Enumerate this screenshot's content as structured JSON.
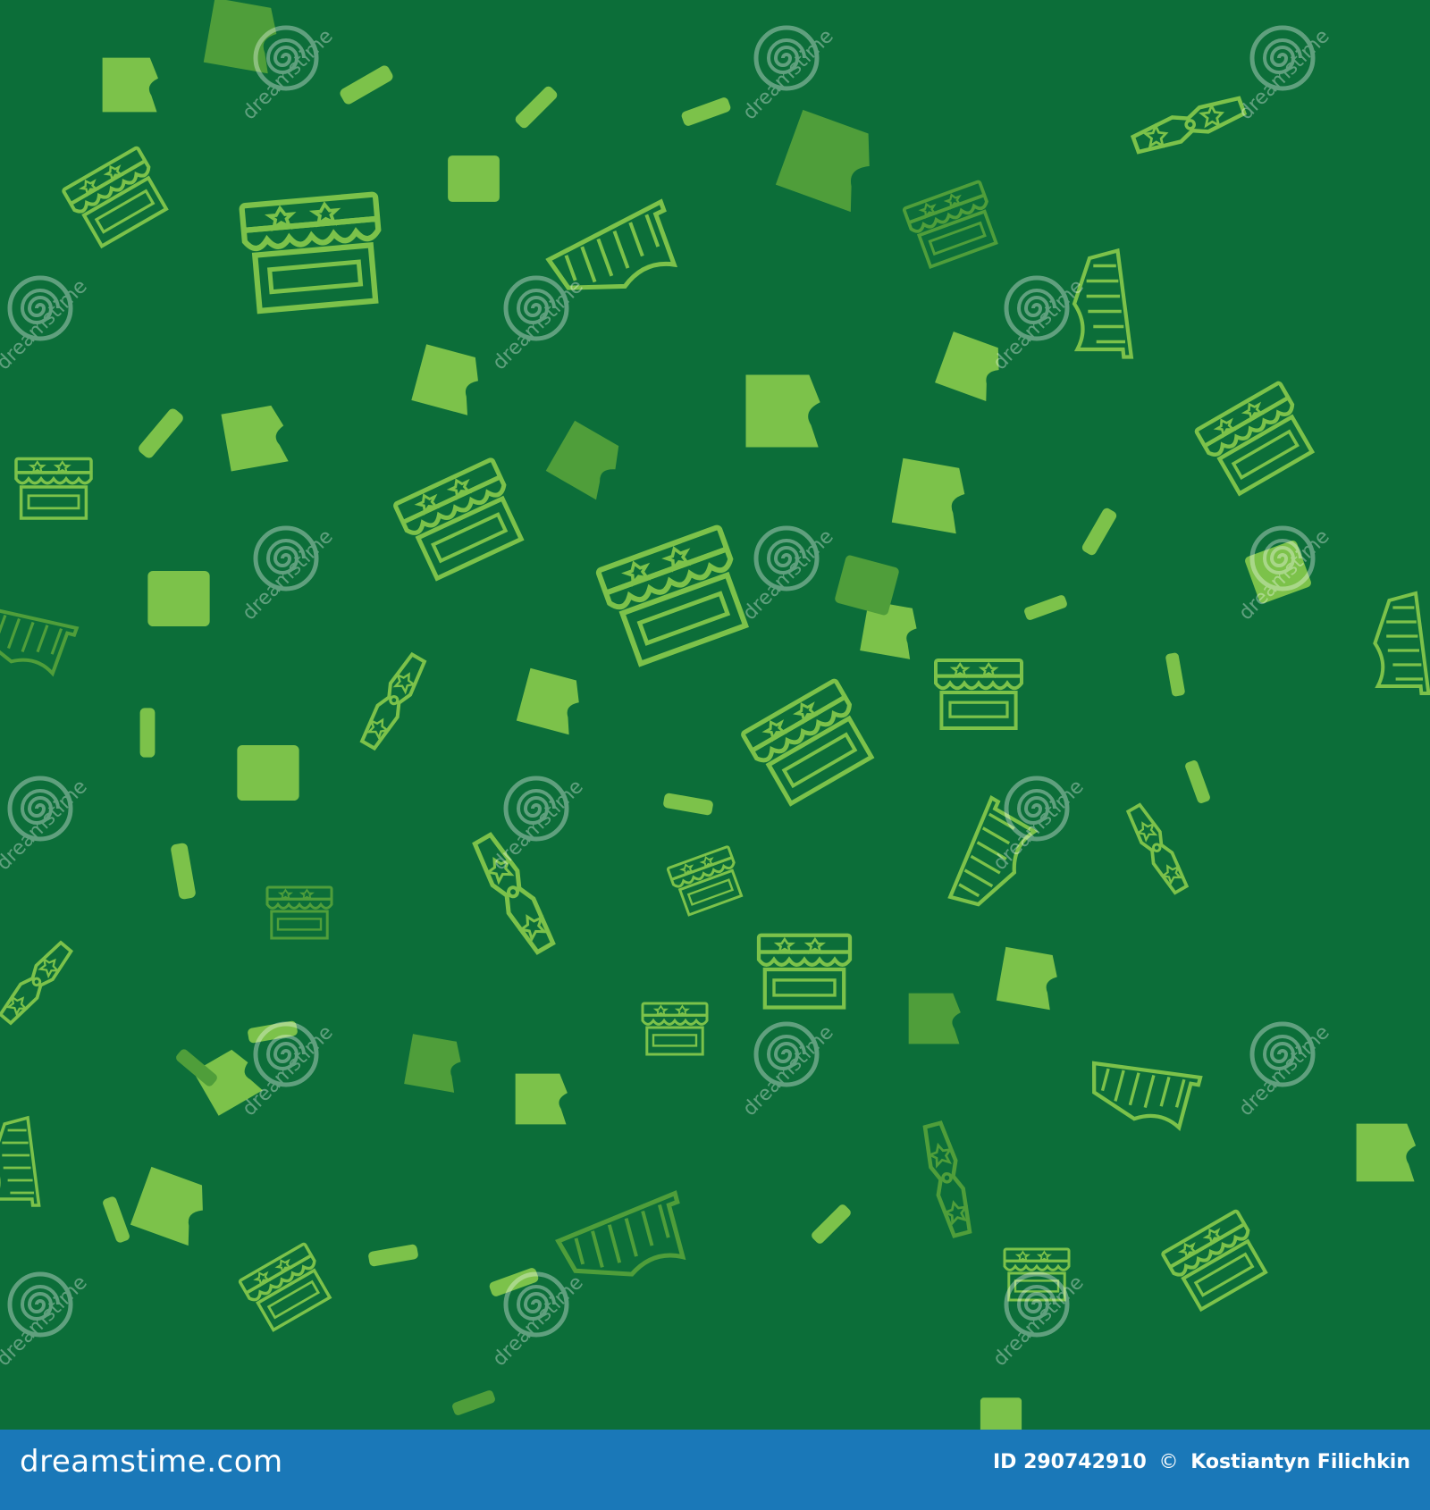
{
  "image": {
    "background_color": "#0c6e39",
    "icon_color": "#7cc24a",
    "icon_color_dim": "#4f9e3a",
    "watermark_text": "dreamstime",
    "icons": [
      "market-stall-icon",
      "clothes-peg-icon",
      "grand-piano-icon",
      "pan-flute-icon"
    ]
  },
  "footer": {
    "bg": "#1a78b8",
    "site": "dreamstime.com",
    "id_label": "ID",
    "id_value": "290742910",
    "copyright_symbol": "©",
    "author": "Kostiantyn Filichkin"
  }
}
